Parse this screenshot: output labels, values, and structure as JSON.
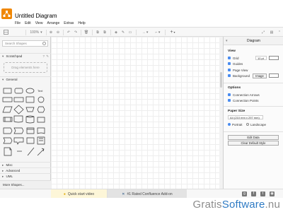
{
  "app": {
    "title": "Untitled Diagram"
  },
  "menu": [
    "File",
    "Edit",
    "View",
    "Arrange",
    "Extras",
    "Help"
  ],
  "toolbar": {
    "zoom": "100%",
    "add_symbol": "+"
  },
  "sidebar": {
    "search_placeholder": "Search Shapes",
    "scratchpad": "Scratchpad",
    "drop_hint": "Drag elements here",
    "general": "General",
    "sections": [
      "Misc",
      "Advanced",
      "UML"
    ],
    "more_shapes": "More Shapes...",
    "shape_text_label": "Text"
  },
  "panel": {
    "title": "Diagram",
    "view_heading": "View",
    "grid_label": "Grid",
    "grid_size": "10 pt",
    "guides_label": "Guides",
    "page_view_label": "Page View",
    "background_label": "Background",
    "image_button": "Image",
    "options_heading": "Options",
    "connection_arrows": "Connection Arrows",
    "connection_points": "Connection Points",
    "paper_heading": "Paper Size",
    "paper_value": "A4 (210 mm x 297 mm)",
    "portrait": "Portrait",
    "landscape": "Landscape",
    "edit_data": "Edit Data",
    "clear_style": "Clear Default Style"
  },
  "footer": {
    "video_tab": "Quick start video",
    "confluence_tab": "#1 Rated Confluence Add-on"
  },
  "watermark": {
    "part1": "Gratis",
    "part2": "Software",
    "part3": ".nu"
  },
  "colors": {
    "logo": "#f08705",
    "checkbox": "#4a8cf0",
    "watermark_blue": "#2f7bc4",
    "watermark_gray": "#8c8c8c"
  }
}
